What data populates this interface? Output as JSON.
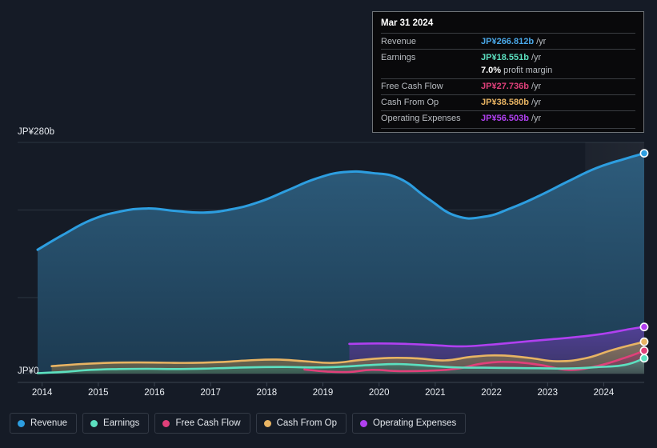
{
  "chart_data": {
    "type": "area",
    "title": "",
    "xlabel": "",
    "ylabel": "",
    "currency": "JP¥",
    "unit": "b",
    "period": "/yr",
    "grid": true,
    "legend_position": "bottom",
    "ylim": [
      0,
      280
    ],
    "xlim": [
      2013.45,
      2024.25
    ],
    "y_ticks": [
      {
        "value": 280,
        "label": "JP¥280b"
      },
      {
        "value": 0,
        "label": "JP¥0"
      }
    ],
    "gridlines_y": [
      280,
      198,
      92,
      0
    ],
    "x_ticks": [
      "2014",
      "2015",
      "2016",
      "2017",
      "2018",
      "2019",
      "2020",
      "2021",
      "2022",
      "2023",
      "2024"
    ],
    "forecast_divider_x": 2023.2,
    "series": [
      {
        "name": "Revenue",
        "color": "#2d9ee0",
        "fill_top": "#2e5f80",
        "fill_bottom": "#1d3c53",
        "start_x": 2013.45,
        "x": [
          2013.45,
          2013.9,
          2014.4,
          2014.9,
          2015.4,
          2015.9,
          2016.4,
          2016.9,
          2017.4,
          2017.9,
          2018.4,
          2018.9,
          2019.4,
          2019.9,
          2020.4,
          2020.9,
          2021.4,
          2021.9,
          2022.4,
          2022.9,
          2023.4,
          2023.9,
          2024.25
        ],
        "values": [
          150,
          168,
          186,
          196,
          200,
          197,
          195,
          199,
          208,
          222,
          236,
          244,
          243,
          236,
          212,
          191,
          190,
          201,
          216,
          233,
          249,
          260,
          266.812
        ]
      },
      {
        "name": "Earnings",
        "color": "#5ce0c0",
        "fill_top": "#3f7f72",
        "fill_bottom": "#2a5c55",
        "start_x": 2013.45,
        "x": [
          2013.45,
          2013.9,
          2014.4,
          2014.9,
          2015.4,
          2015.9,
          2016.4,
          2016.9,
          2017.4,
          2017.9,
          2018.4,
          2018.9,
          2019.4,
          2019.9,
          2020.4,
          2020.9,
          2021.4,
          2021.9,
          2022.4,
          2022.9,
          2023.4,
          2023.9,
          2024.25
        ],
        "values": [
          0.5,
          2.0,
          4.5,
          5.5,
          5.8,
          5.5,
          6.0,
          7.0,
          7.8,
          8.0,
          7.5,
          8.5,
          10.5,
          11.5,
          9.5,
          7.5,
          7.2,
          6.8,
          6.5,
          6.2,
          7.8,
          10.5,
          18.551
        ]
      },
      {
        "name": "Free Cash Flow",
        "color": "#e0407a",
        "fill_top": "#8c3a60",
        "fill_bottom": "#6b3552",
        "start_x": 2018.2,
        "x": [
          2018.2,
          2018.6,
          2019.0,
          2019.4,
          2019.9,
          2020.4,
          2020.9,
          2021.4,
          2021.9,
          2022.4,
          2022.9,
          2023.4,
          2023.9,
          2024.25
        ],
        "values": [
          5.0,
          2.5,
          2.0,
          4.5,
          3.0,
          3.5,
          5.8,
          12.5,
          14.0,
          10.5,
          4.5,
          9.0,
          19.0,
          27.736
        ]
      },
      {
        "name": "Cash From Op",
        "color": "#e8b463",
        "fill_top": "#8c7a55",
        "fill_bottom": "#6d6248",
        "start_x": 2013.7,
        "x": [
          2013.7,
          2014.2,
          2014.7,
          2015.2,
          2015.7,
          2016.2,
          2016.7,
          2017.2,
          2017.7,
          2018.2,
          2018.7,
          2019.2,
          2019.7,
          2020.2,
          2020.7,
          2021.2,
          2021.7,
          2022.2,
          2022.7,
          2023.2,
          2023.7,
          2024.25
        ],
        "values": [
          9.0,
          11.5,
          13.0,
          13.5,
          13.2,
          13.0,
          14.0,
          16.0,
          17.0,
          15.0,
          13.0,
          16.5,
          19.0,
          18.5,
          16.0,
          20.5,
          22.0,
          19.0,
          15.0,
          18.5,
          29.0,
          38.58
        ]
      },
      {
        "name": "Operating Expenses",
        "color": "#b040f0",
        "fill_top": "#4a3a80",
        "fill_bottom": "#3d3468",
        "start_x": 2019.0,
        "x": [
          2019.0,
          2019.5,
          2020.0,
          2020.5,
          2021.0,
          2021.5,
          2022.0,
          2022.5,
          2023.0,
          2023.5,
          2024.0,
          2024.25
        ],
        "values": [
          36.0,
          36.5,
          36.0,
          34.5,
          33.0,
          35.0,
          38.0,
          41.0,
          44.0,
          48.0,
          54.0,
          56.503
        ]
      }
    ]
  },
  "tooltip": {
    "date": "Mar 31 2024",
    "rows": [
      {
        "key": "Revenue",
        "value": "JP¥266.812b",
        "unit": "/yr",
        "color": "#4aa8e8"
      },
      {
        "key": "Earnings",
        "value": "JP¥18.551b",
        "unit": "/yr",
        "color": "#5ce0c0"
      },
      {
        "key": "",
        "value": "7.0%",
        "unit": "profit margin",
        "color": "#ffffff",
        "sub": true
      },
      {
        "key": "Free Cash Flow",
        "value": "JP¥27.736b",
        "unit": "/yr",
        "color": "#e0407a"
      },
      {
        "key": "Cash From Op",
        "value": "JP¥38.580b",
        "unit": "/yr",
        "color": "#e8b463"
      },
      {
        "key": "Operating Expenses",
        "value": "JP¥56.503b",
        "unit": "/yr",
        "color": "#b040f0"
      }
    ]
  },
  "legend": {
    "items": [
      {
        "label": "Revenue",
        "color": "#2d9ee0"
      },
      {
        "label": "Earnings",
        "color": "#5ce0c0"
      },
      {
        "label": "Free Cash Flow",
        "color": "#e0407a"
      },
      {
        "label": "Cash From Op",
        "color": "#e8b463"
      },
      {
        "label": "Operating Expenses",
        "color": "#b040f0"
      }
    ]
  },
  "colors": {
    "background": "#151b26",
    "grid": "#2b3440",
    "axis_text": "#e9edf2",
    "tooltip_bg": "#09090b",
    "tooltip_border": "#6f7378"
  }
}
